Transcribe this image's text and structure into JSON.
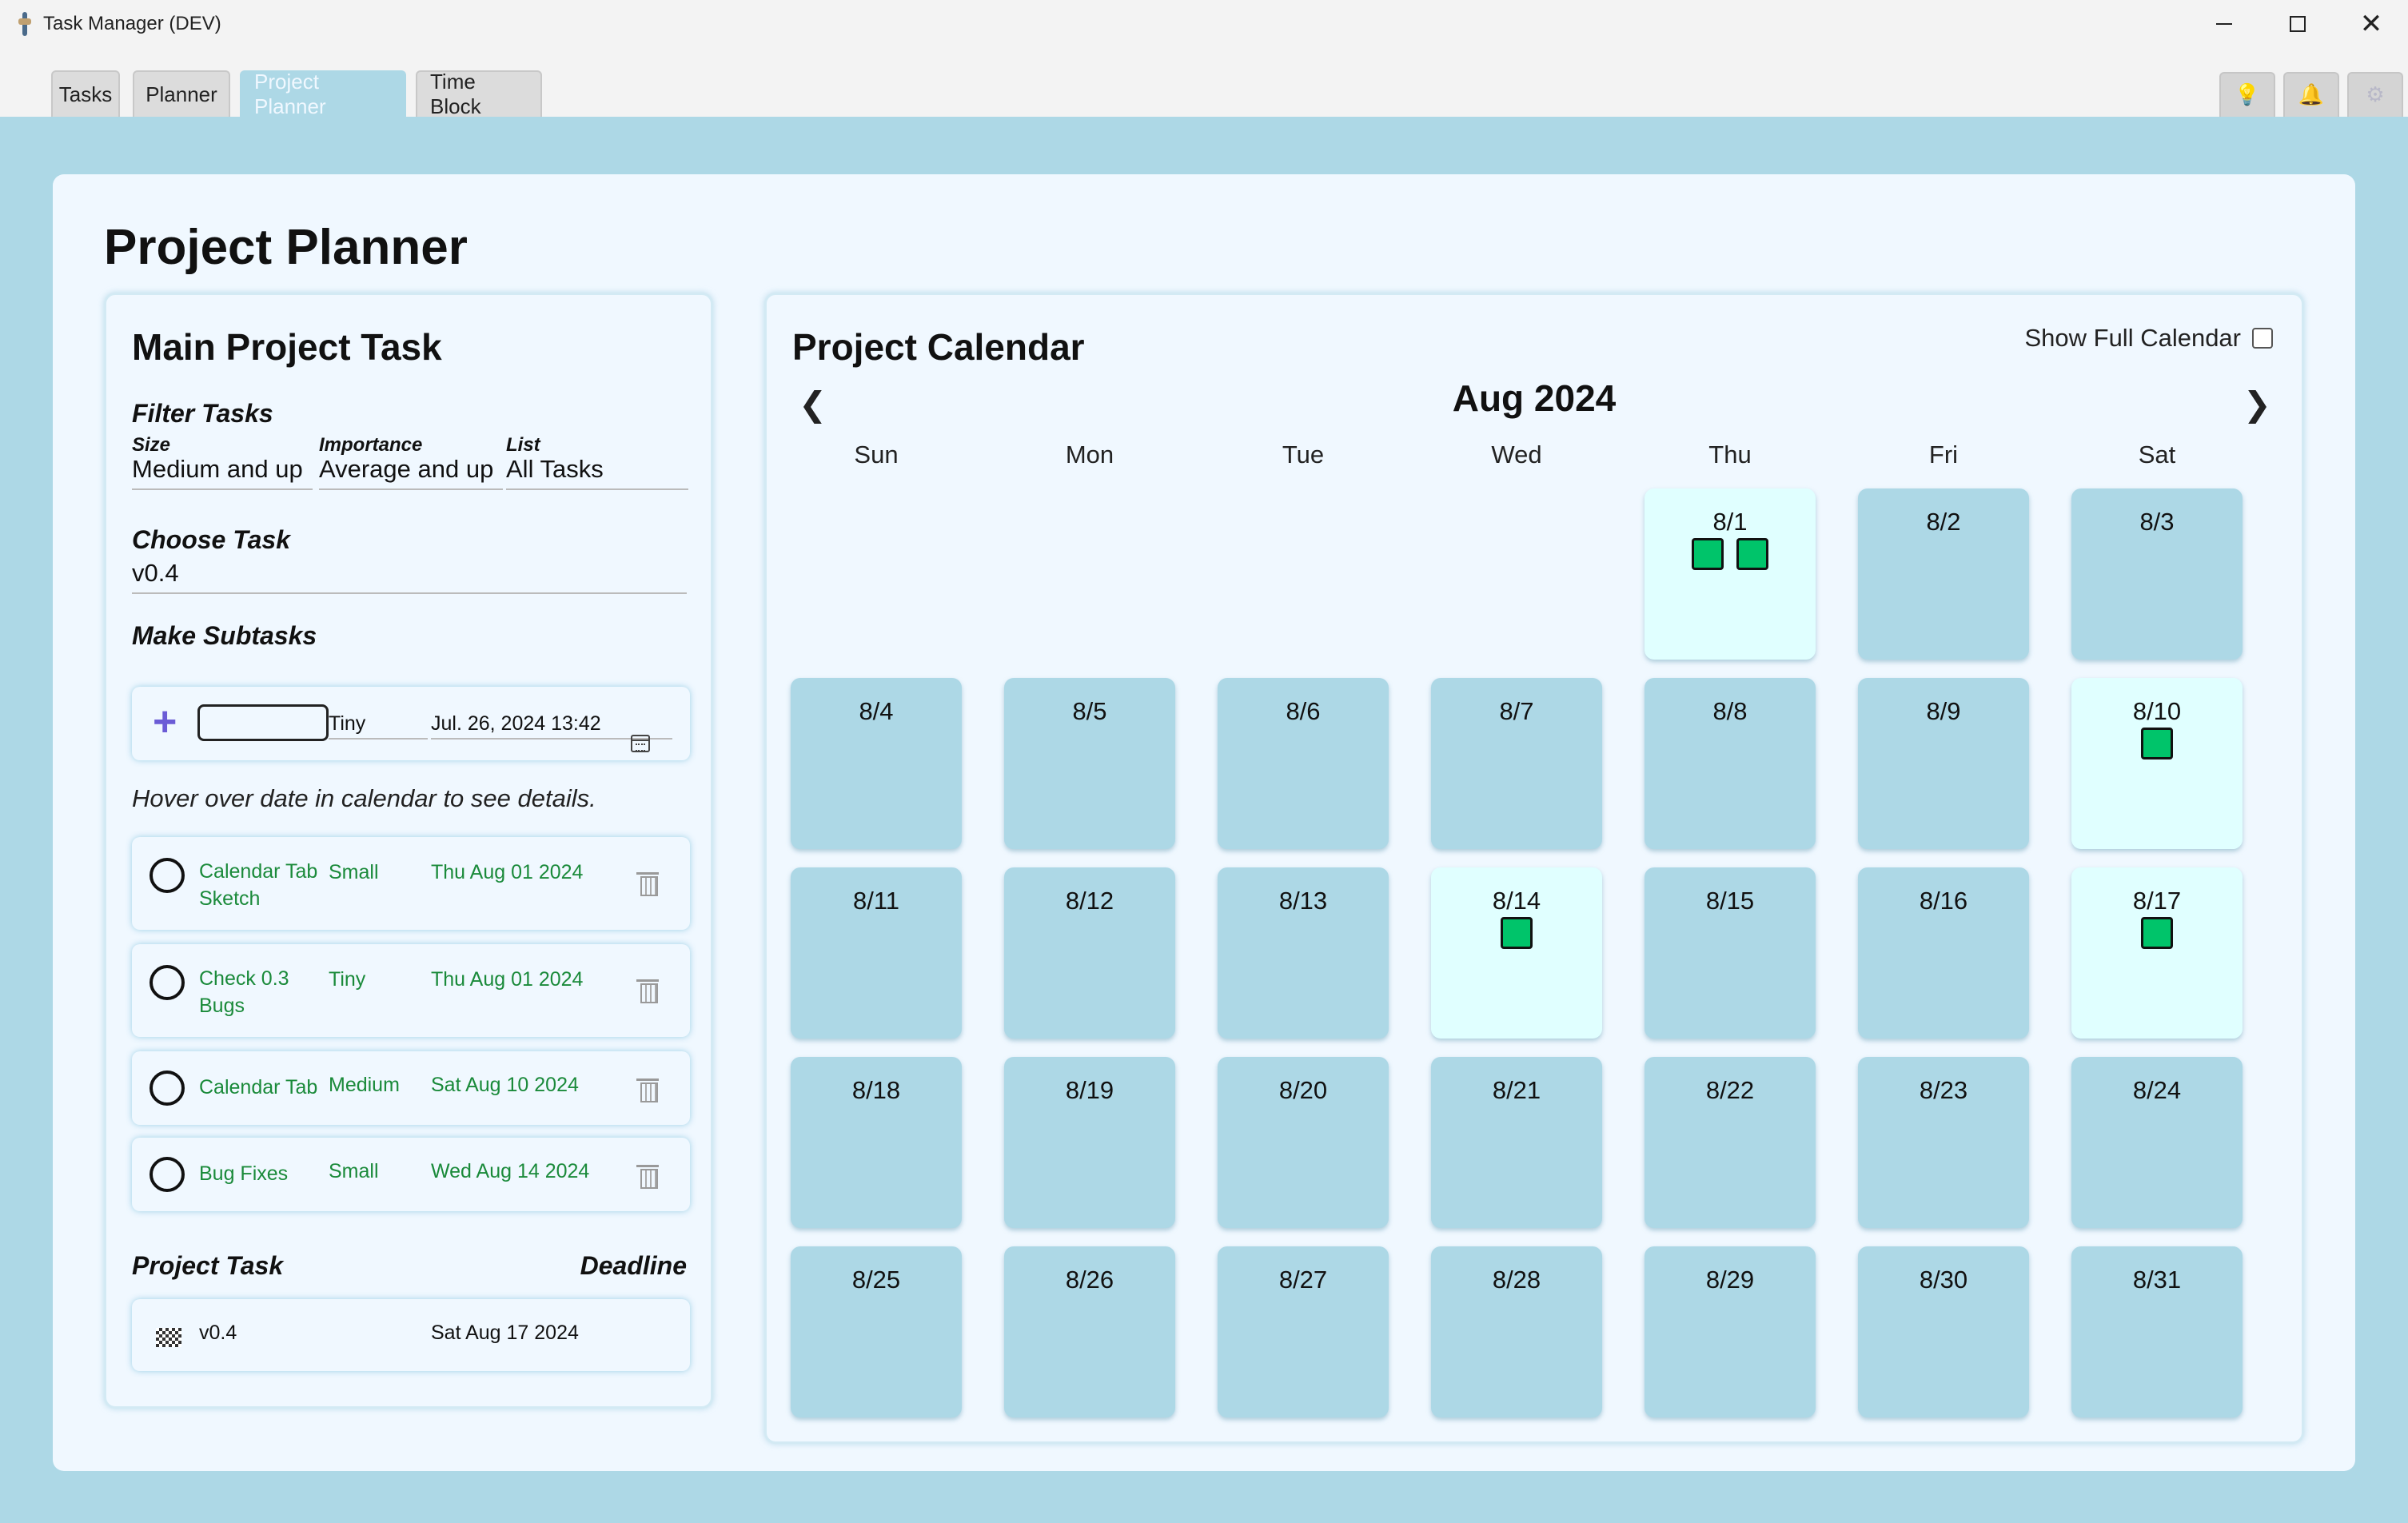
{
  "window": {
    "title": "Task Manager (DEV)",
    "minimize": "",
    "maximize": "",
    "close": "✕"
  },
  "tabs": [
    {
      "label": "Tasks"
    },
    {
      "label": "Planner"
    },
    {
      "label": "Project Planner"
    },
    {
      "label": "Time Block"
    }
  ],
  "active_tab": "Project Planner",
  "header_icons": [
    "lightbulb-icon",
    "bell-icon",
    "gear-icon"
  ],
  "page": {
    "title": "Project Planner"
  },
  "main_task_panel": {
    "heading": "Main Project Task",
    "filter_label": "Filter Tasks",
    "filters": {
      "size_label": "Size",
      "size_value": "Medium and up",
      "importance_label": "Importance",
      "importance_value": "Average and up",
      "list_label": "List",
      "list_value": "All Tasks"
    },
    "choose_label": "Choose Task",
    "choose_value": "v0.4",
    "make_subtasks_label": "Make Subtasks",
    "new_subtask": {
      "name_value": "",
      "size_value": "Tiny",
      "date_value": "Jul. 26, 2024 13:42"
    },
    "hint": "Hover over date in calendar to see details.",
    "subtasks": [
      {
        "name": "Calendar Tab Sketch",
        "size": "Small",
        "date": "Thu Aug 01 2024"
      },
      {
        "name": "Check 0.3 Bugs",
        "size": "Tiny",
        "date": "Thu Aug 01 2024"
      },
      {
        "name": "Calendar Tab",
        "size": "Medium",
        "date": "Sat Aug 10 2024"
      },
      {
        "name": "Bug Fixes",
        "size": "Small",
        "date": "Wed Aug 14 2024"
      }
    ],
    "project_task_label": "Project Task",
    "deadline_label": "Deadline",
    "project_task": {
      "name": "v0.4",
      "deadline": "Sat Aug 17 2024"
    }
  },
  "calendar_panel": {
    "heading": "Project Calendar",
    "show_full_label": "Show Full Calendar",
    "show_full_checked": false,
    "month": "Aug 2024",
    "prev_arrow": "❮",
    "next_arrow": "❯",
    "weekdays": [
      "Sun",
      "Mon",
      "Tue",
      "Wed",
      "Thu",
      "Fri",
      "Sat"
    ],
    "first_weekday_index": 4,
    "days": [
      {
        "label": "8/1",
        "tasks": 2
      },
      {
        "label": "8/2",
        "tasks": 0
      },
      {
        "label": "8/3",
        "tasks": 0
      },
      {
        "label": "8/4",
        "tasks": 0
      },
      {
        "label": "8/5",
        "tasks": 0
      },
      {
        "label": "8/6",
        "tasks": 0
      },
      {
        "label": "8/7",
        "tasks": 0
      },
      {
        "label": "8/8",
        "tasks": 0
      },
      {
        "label": "8/9",
        "tasks": 0
      },
      {
        "label": "8/10",
        "tasks": 1
      },
      {
        "label": "8/11",
        "tasks": 0
      },
      {
        "label": "8/12",
        "tasks": 0
      },
      {
        "label": "8/13",
        "tasks": 0
      },
      {
        "label": "8/14",
        "tasks": 1
      },
      {
        "label": "8/15",
        "tasks": 0
      },
      {
        "label": "8/16",
        "tasks": 0
      },
      {
        "label": "8/17",
        "tasks": 1
      },
      {
        "label": "8/18",
        "tasks": 0
      },
      {
        "label": "8/19",
        "tasks": 0
      },
      {
        "label": "8/20",
        "tasks": 0
      },
      {
        "label": "8/21",
        "tasks": 0
      },
      {
        "label": "8/22",
        "tasks": 0
      },
      {
        "label": "8/23",
        "tasks": 0
      },
      {
        "label": "8/24",
        "tasks": 0
      },
      {
        "label": "8/25",
        "tasks": 0
      },
      {
        "label": "8/26",
        "tasks": 0
      },
      {
        "label": "8/27",
        "tasks": 0
      },
      {
        "label": "8/28",
        "tasks": 0
      },
      {
        "label": "8/29",
        "tasks": 0
      },
      {
        "label": "8/30",
        "tasks": 0
      },
      {
        "label": "8/31",
        "tasks": 0
      }
    ]
  },
  "colors": {
    "background": "#add8e6",
    "card": "#f0f8ff",
    "day_cell": "#add8e6",
    "day_cell_with_task": "#e0ffff",
    "task_marker": "#00c46a",
    "subtask_text": "#1a8a3a",
    "add_button": "#6b5cd6"
  }
}
